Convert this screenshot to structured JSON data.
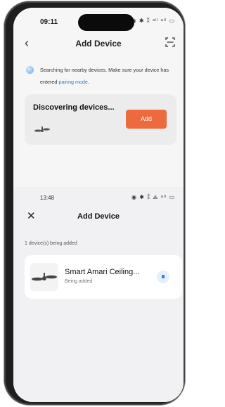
{
  "top_screen": {
    "status_time": "09:11",
    "status_icons": "◉ ✱ ⁑ ᵃˡˡ ᵃˡˡ ▭",
    "title": "Add Device",
    "searching_text": "Searching for nearby devices. Make sure your device has entered ",
    "pairing_link": "pairing mode",
    "searching_end": ".",
    "discovering_title": "Discovering devices...",
    "add_button": "Add"
  },
  "bottom_screen": {
    "status_time": "13:48",
    "status_icons": "◉ ✱ ⁑ ⟁ ᵃˡˡ ▭",
    "title": "Add Device",
    "count_text": "1 device(s) being added",
    "device": {
      "name": "Smart Amari Ceiling...",
      "status": "Being added"
    }
  },
  "icons": {
    "back": "chevron-left-icon",
    "scan": "scan-icon",
    "close": "close-icon",
    "fan": "ceiling-fan-icon",
    "status": "loading-icon"
  },
  "colors": {
    "accent": "#ec6a3d",
    "link": "#2a79d6"
  }
}
